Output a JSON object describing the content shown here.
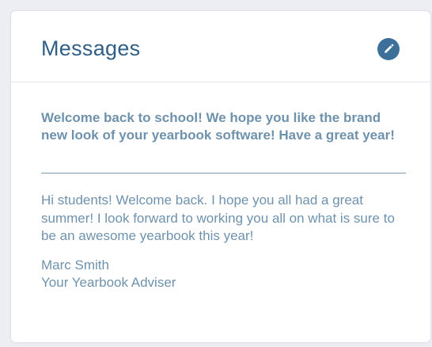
{
  "messages_card": {
    "title": "Messages",
    "edit_icon": "pencil-icon",
    "headline": "Welcome back to school! We hope you like the brand new look of your yearbook software! Have a great year!",
    "body": "Hi students! Welcome back. I hope you all had a great summer! I look forward to working you all on what is sure to be an awesome yearbook this year!",
    "signature": {
      "name": "Marc Smith",
      "role": "Your Yearbook Adviser"
    }
  },
  "colors": {
    "title": "#2f5f86",
    "text": "#6f92ac",
    "icon_background": "#3c6f99",
    "page_background": "#eceef4"
  }
}
